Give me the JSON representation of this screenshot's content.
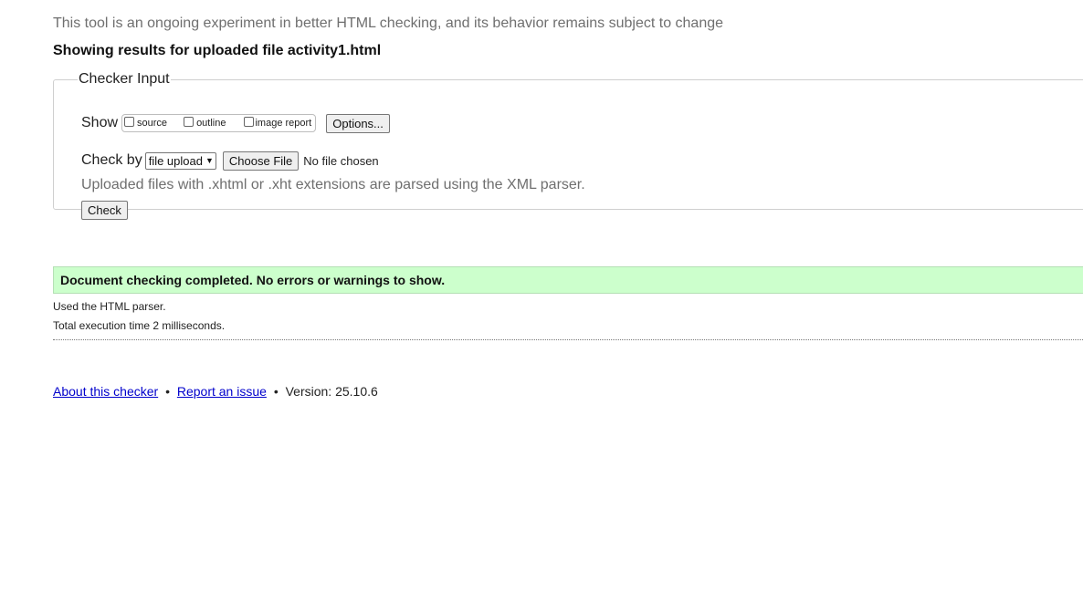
{
  "notice": "This tool is an ongoing experiment in better HTML checking, and its behavior remains subject to change",
  "results_heading": "Showing results for uploaded file activity1.html",
  "checker_input": {
    "legend": "Checker Input",
    "show_label": "Show",
    "show_options": [
      {
        "label": "source",
        "checked": false
      },
      {
        "label": "outline",
        "checked": false
      },
      {
        "label": "image report",
        "checked": false
      }
    ],
    "options_button": "Options...",
    "check_by_label": "Check by",
    "check_by_selected": "file upload",
    "choose_file_button": "Choose File",
    "file_status": "No file chosen",
    "help_text": "Uploaded files with .xhtml or .xht extensions are parsed using the XML parser.",
    "check_button": "Check"
  },
  "result": {
    "success_message": "Document checking completed. No errors or warnings to show.",
    "parser_note": "Used the HTML parser.",
    "execution_time": "Total execution time 2 milliseconds."
  },
  "footer": {
    "about_link": "About this checker",
    "bullet": "•",
    "report_link": "Report an issue",
    "version_text": "Version: 25.10.6"
  },
  "colors": {
    "success_bg": "#ccffcc",
    "link": "#0000cc",
    "muted_text": "#6f6f6f"
  }
}
